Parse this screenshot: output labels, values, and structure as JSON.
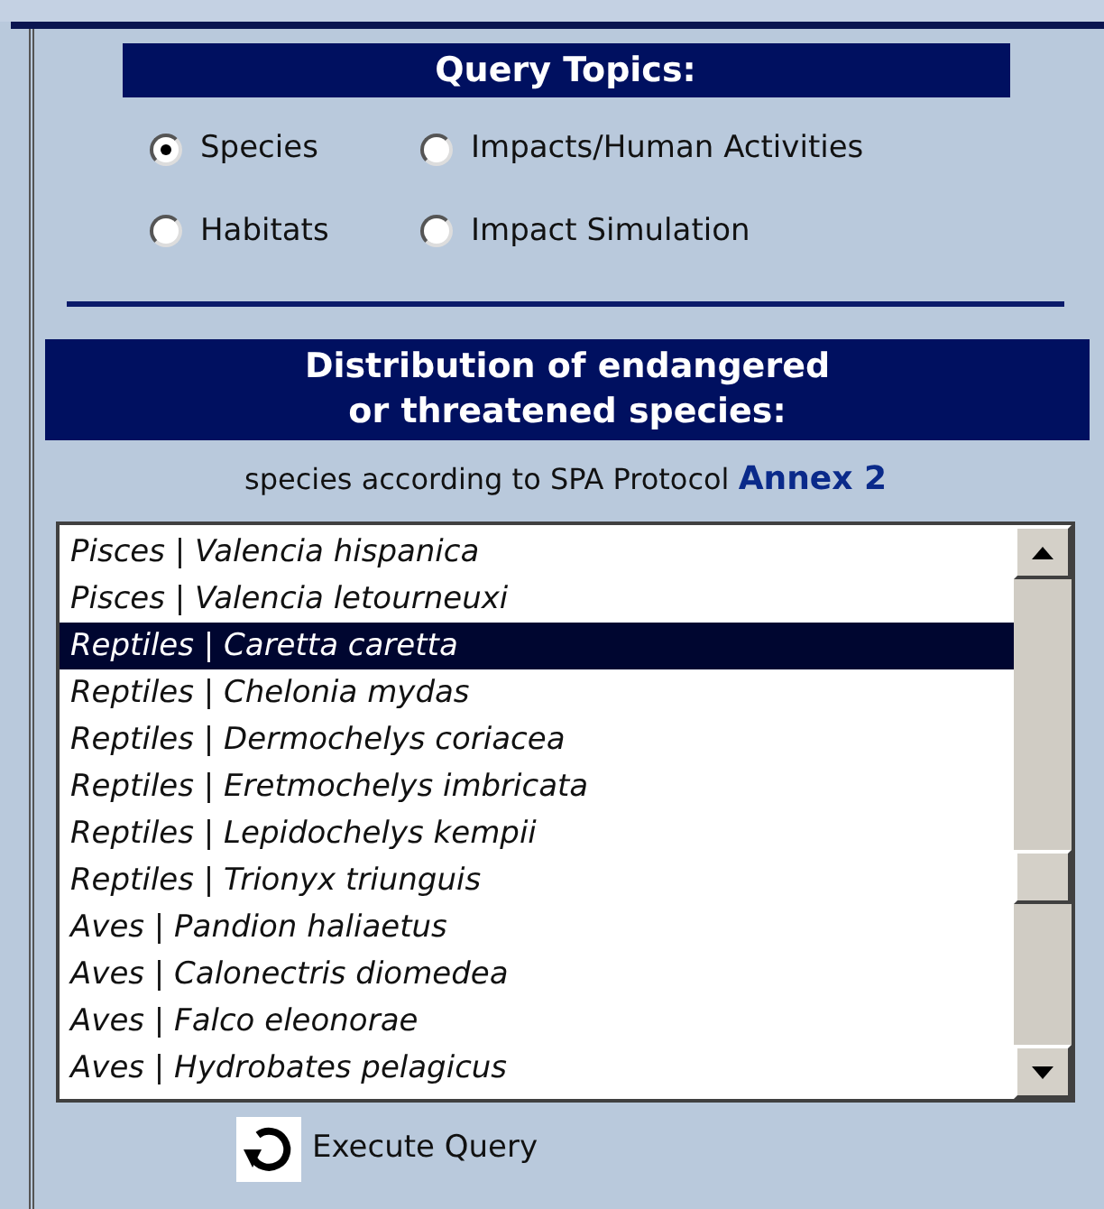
{
  "query_topics": {
    "title": "Query Topics:",
    "options": [
      {
        "label": "Species",
        "selected": true
      },
      {
        "label": "Impacts/Human Activities",
        "selected": false
      },
      {
        "label": "Habitats",
        "selected": false
      },
      {
        "label": "Impact Simulation",
        "selected": false
      }
    ]
  },
  "section": {
    "title_lines": [
      "Distribution of endangered",
      "or threatened species:"
    ],
    "subtitle": "species according to SPA Protocol",
    "link": "Annex 2"
  },
  "species_list": [
    {
      "label": "Pisces | Valencia hispanica",
      "selected": false
    },
    {
      "label": "Pisces | Valencia letourneuxi",
      "selected": false
    },
    {
      "label": "Reptiles | Caretta caretta",
      "selected": true
    },
    {
      "label": "Reptiles | Chelonia mydas",
      "selected": false
    },
    {
      "label": "Reptiles | Dermochelys coriacea",
      "selected": false
    },
    {
      "label": "Reptiles | Eretmochelys imbricata",
      "selected": false
    },
    {
      "label": "Reptiles | Lepidochelys kempii",
      "selected": false
    },
    {
      "label": "Reptiles | Trionyx triunguis",
      "selected": false
    },
    {
      "label": "Aves | Pandion haliaetus",
      "selected": false
    },
    {
      "label": "Aves | Calonectris diomedea",
      "selected": false
    },
    {
      "label": "Aves | Falco eleonorae",
      "selected": false
    },
    {
      "label": "Aves | Hydrobates pelagicus",
      "selected": false
    }
  ],
  "execute_button": "Execute Query"
}
